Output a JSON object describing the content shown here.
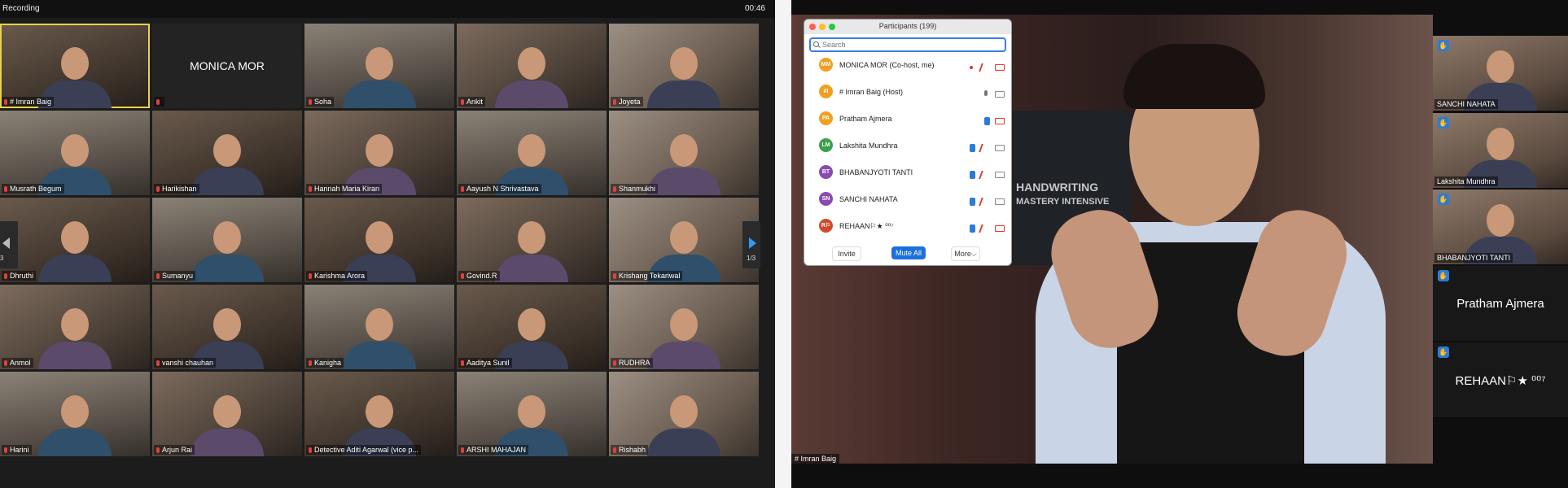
{
  "meeting": {
    "recording_label": "Recording",
    "timer": "00:46"
  },
  "gallery": {
    "tiles": [
      {
        "name": "# Imran Baig",
        "video": true,
        "selected": true
      },
      {
        "name": "",
        "display": "MONICA MOR",
        "video": false
      },
      {
        "name": "Soha",
        "video": true
      },
      {
        "name": "Ankit",
        "video": true
      },
      {
        "name": "Joyeta",
        "video": true
      },
      {
        "name": "Musrath Begum",
        "video": true
      },
      {
        "name": "Harikishan",
        "video": true
      },
      {
        "name": "Hannah Maria Kiran",
        "video": true
      },
      {
        "name": "Aayush N Shrivastava",
        "video": true
      },
      {
        "name": "Shanmukhi",
        "video": true
      },
      {
        "name": "Dhruthi",
        "video": true
      },
      {
        "name": "Sumanyu",
        "video": true
      },
      {
        "name": "Karishma Arora",
        "video": true
      },
      {
        "name": "Govind.R",
        "video": true
      },
      {
        "name": "Krishang Tekariwal",
        "video": true
      },
      {
        "name": "Anmol",
        "video": true
      },
      {
        "name": "vanshi chauhan",
        "video": true
      },
      {
        "name": "Kanigha",
        "video": true
      },
      {
        "name": "Aaditya Sunil",
        "video": true
      },
      {
        "name": "RUDHRA",
        "video": true
      },
      {
        "name": "Harini",
        "video": true
      },
      {
        "name": "Arjun Rai",
        "video": true
      },
      {
        "name": "Detective Aditi Agarwal (vice p...",
        "video": true
      },
      {
        "name": "ARSHI MAHAJAN",
        "video": true
      },
      {
        "name": "Rishabh",
        "video": true
      }
    ],
    "prev_page": "3",
    "next_page": "1/3"
  },
  "speaker": {
    "name": "# Imran Baig",
    "poster_line1": "HANDWRITING",
    "poster_line2": "MASTERY INTENSIVE"
  },
  "strip": {
    "tiles": [
      {
        "name": "SANCHI NAHATA",
        "video": true
      },
      {
        "name": "Lakshita Mundhra",
        "video": true
      },
      {
        "name": "BHABANJYOTI TANTI",
        "video": true
      },
      {
        "name": "",
        "display": "Pratham Ajmera",
        "video": false
      },
      {
        "name": "",
        "display": "REHAAN⚐★ ⁰⁰⁷",
        "video": false
      }
    ]
  },
  "participants": {
    "title": "Participants (199)",
    "search_placeholder": "Search",
    "list": [
      {
        "initials": "MM",
        "name": "MONICA MOR (Co-host, me)",
        "color": "#f0a020",
        "icons": [
          "rec",
          "mic-off",
          "cam-off"
        ]
      },
      {
        "initials": "#I",
        "name": "# Imran Baig (Host)",
        "color": "#f0a020",
        "icons": [
          "mic-on",
          "cam-on"
        ]
      },
      {
        "initials": "PA",
        "name": "Pratham Ajmera",
        "color": "#f0a020",
        "icons": [
          "hand",
          "cam-off"
        ]
      },
      {
        "initials": "LM",
        "name": "Lakshita Mundhra",
        "color": "#3aa04a",
        "icons": [
          "hand",
          "mic-off",
          "cam-on"
        ]
      },
      {
        "initials": "BT",
        "name": "BHABANJYOTI TANTI",
        "color": "#8a4ab0",
        "icons": [
          "hand",
          "mic-off",
          "cam-on"
        ]
      },
      {
        "initials": "SN",
        "name": "SANCHI NAHATA",
        "color": "#8a4ab0",
        "icons": [
          "hand",
          "mic-off",
          "cam-on"
        ]
      },
      {
        "initials": "R⚐",
        "name": "REHAAN⚐★ ⁰⁰⁷",
        "color": "#d04a2a",
        "icons": [
          "hand",
          "mic-off",
          "cam-off"
        ]
      }
    ],
    "buttons": {
      "invite": "Invite",
      "mute_all": "Mute All",
      "more": "More⌵"
    }
  },
  "colors": {
    "accent": "#1b70e0",
    "selected_outline": "#e8d24a",
    "muted_red": "#e0382e",
    "raise_hand": "#2c7bd9"
  }
}
